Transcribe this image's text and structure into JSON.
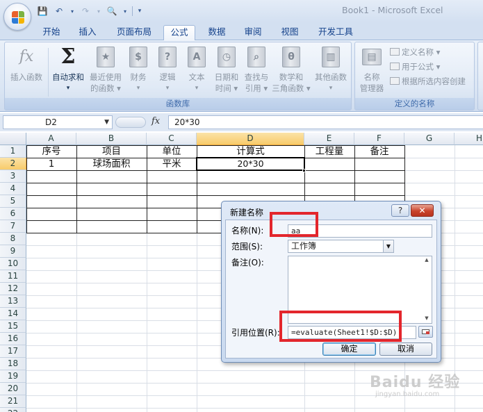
{
  "window": {
    "title": "Book1 - Microsoft Excel"
  },
  "tabs": [
    "开始",
    "插入",
    "页面布局",
    "公式",
    "数据",
    "审阅",
    "视图",
    "开发工具"
  ],
  "active_tab": "公式",
  "ribbon": {
    "function_library": {
      "label": "函数库",
      "insert_function": "插入函数",
      "autosum": {
        "line1": "自动求和",
        "arrow": "▾"
      },
      "recently_used": {
        "line1": "最近使用",
        "line2": "的函数 ▾"
      },
      "financial": {
        "line1": "财务",
        "line2": "▾"
      },
      "logical": {
        "line1": "逻辑",
        "line2": "▾"
      },
      "text": {
        "line1": "文本",
        "line2": "▾"
      },
      "datetime": {
        "line1": "日期和",
        "line2": "时间 ▾"
      },
      "lookup": {
        "line1": "查找与",
        "line2": "引用 ▾"
      },
      "math": {
        "line1": "数学和",
        "line2": "三角函数 ▾"
      },
      "other": {
        "line1": "其他函数",
        "line2": "▾"
      }
    },
    "defined_names": {
      "label": "定义的名称",
      "name_manager": {
        "line1": "名称",
        "line2": "管理器"
      },
      "define_name": "定义名称 ▾",
      "use_in_formula": "用于公式 ▾",
      "create_from_selection": "根据所选内容创建"
    }
  },
  "formula_bar": {
    "name_box": "D2",
    "fx": "fx",
    "formula": "20*30"
  },
  "grid": {
    "columns": [
      "A",
      "B",
      "C",
      "D",
      "E",
      "F",
      "G",
      "H"
    ],
    "selected_column": "D",
    "rows": [
      "1",
      "2",
      "3",
      "4",
      "5",
      "6",
      "7",
      "8",
      "9",
      "10",
      "11",
      "12",
      "13",
      "14",
      "15",
      "16",
      "17",
      "18",
      "19",
      "20",
      "21",
      "22"
    ],
    "selected_row": "2",
    "header_row": [
      "序号",
      "项目",
      "单位",
      "计算式",
      "工程量",
      "备注"
    ],
    "data_row": [
      "1",
      "球场面积",
      "平米",
      "20*30",
      "",
      ""
    ]
  },
  "dialog": {
    "title": "新建名称",
    "help": "?",
    "close": "✕",
    "name_label": "名称(N):",
    "name_value": "aa",
    "scope_label": "范围(S):",
    "scope_value": "工作簿",
    "comment_label": "备注(O):",
    "refers_label": "引用位置(R):",
    "refers_value": "=evaluate(Sheet1!$D:$D)",
    "ok": "确定",
    "cancel": "取消"
  },
  "watermark": {
    "main": "Baidu 经验",
    "sub": "jingyan.baidu.com"
  }
}
